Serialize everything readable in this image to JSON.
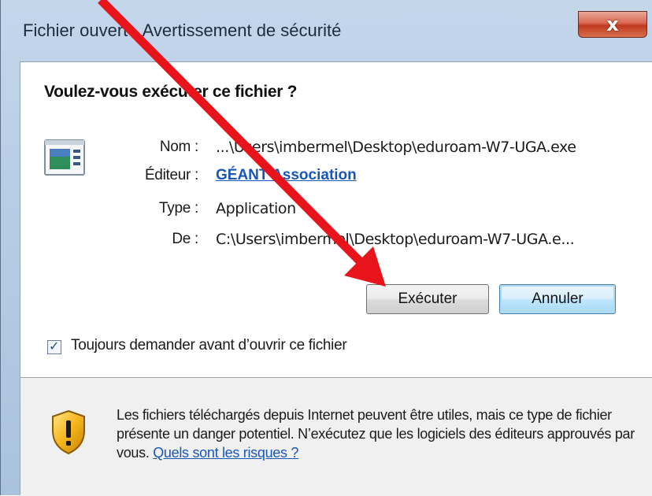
{
  "window": {
    "title": "Fichier ouvert - Avertissement de sécurité",
    "close_label": "x"
  },
  "dialog": {
    "question": "Voulez-vous exécuter ce fichier ?",
    "fields": [
      {
        "label": "Nom :",
        "value": "...\\Users\\imbermel\\Desktop\\eduroam-W7-UGA.exe"
      },
      {
        "label": "Éditeur :",
        "value": "GÉANT Association"
      },
      {
        "label": "Type :",
        "value": "Application"
      },
      {
        "label": "De :",
        "value": "C:\\Users\\imbermel\\Desktop\\eduroam-W7-UGA.e..."
      }
    ],
    "run_label": "Exécuter",
    "cancel_label": "Annuler",
    "always_ask_label": "Toujours demander avant d’ouvrir ce fichier",
    "always_ask_checked": true,
    "check_glyph": "✓"
  },
  "footer": {
    "warning_text": "Les fichiers téléchargés depuis Internet peuvent être utiles, mais ce type de fichier présente un danger potentiel. N’exécutez que les logiciels des éditeurs approuvés par vous.",
    "risk_link": "Quels sont les risques ?"
  },
  "icons": [
    "application-icon",
    "shield-warning-icon",
    "close-icon",
    "red-arrow-annotation"
  ],
  "colors": {
    "link": "#1a56b8",
    "arrow": "#e8141c",
    "close_button": "#c8452c",
    "frame": "#b7cde6"
  }
}
